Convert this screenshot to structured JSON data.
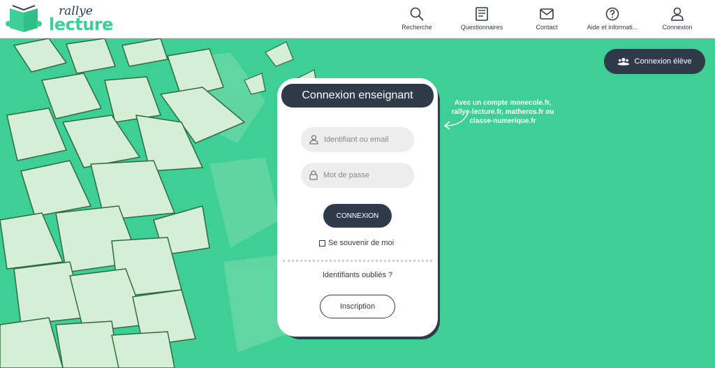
{
  "logo": {
    "word1": "rallye",
    "word2": "lecture",
    "word3": ".fr"
  },
  "nav": [
    {
      "label": "Recherche",
      "icon": "search-icon"
    },
    {
      "label": "Questionnaires",
      "icon": "book-icon"
    },
    {
      "label": "Contact",
      "icon": "mail-icon"
    },
    {
      "label": "Aide et informati...",
      "icon": "help-icon"
    },
    {
      "label": "Connexion",
      "icon": "user-icon"
    }
  ],
  "student_button": {
    "label": "Connexion élève",
    "icon": "users-icon"
  },
  "note": "Avec un compte monecole.fr, rallye-lecture.fr, matheros.fr ou classe-numerique.fr",
  "card": {
    "title": "Connexion enseignant",
    "username_placeholder": "Identifiant ou email",
    "password_placeholder": "Mot de passe",
    "login_label": "CONNEXION",
    "remember_label": "Se souvenir de moi",
    "forgot_label": "Identifiants oubliés ?",
    "signup_label": "Inscription"
  },
  "colors": {
    "brand_green": "#3ecf97",
    "dark": "#2f3a4b",
    "book_fill": "#d4efd6",
    "book_line": "#2f6b3c"
  }
}
